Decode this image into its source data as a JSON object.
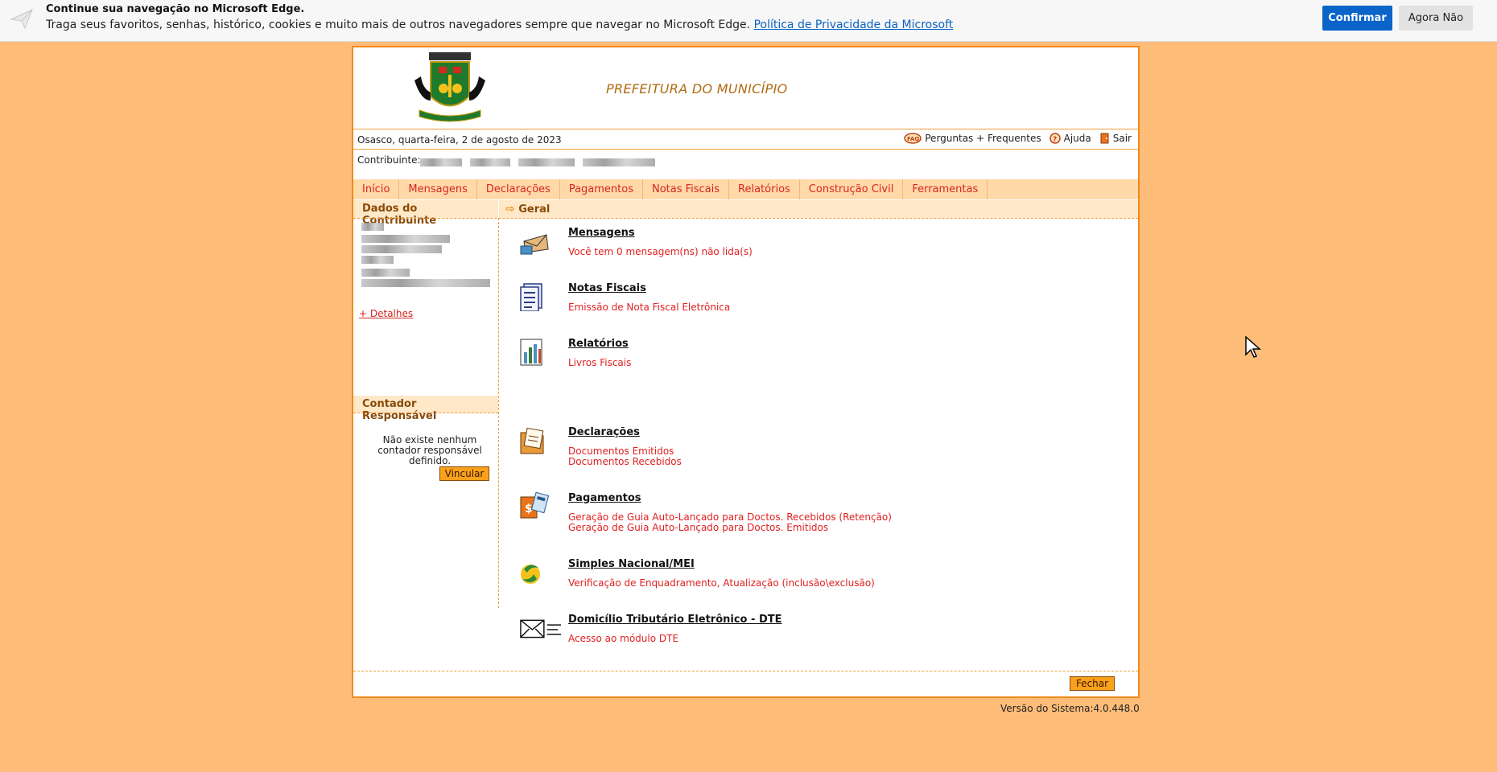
{
  "edge_bar": {
    "title": "Continue sua navegação no Microsoft Edge.",
    "text": "Traga seus favoritos, senhas, histórico, cookies e muito mais de outros navegadores sempre que navegar no Microsoft Edge.",
    "link": "Política de Privacidade da Microsoft",
    "confirm": "Confirmar",
    "later": "Agora Não"
  },
  "header": {
    "title": "PREFEITURA DO MUNICÍPIO"
  },
  "dateline": {
    "date": "Osasco, quarta-feira, 2 de agosto de 2023",
    "links": [
      "Perguntas + Frequentes",
      "Ajuda",
      "Sair"
    ]
  },
  "contribuinte_label": "Contribuinte:",
  "nav": [
    "Início",
    "Mensagens",
    "Declarações",
    "Pagamentos",
    "Notas Fiscais",
    "Relatórios",
    "Construção Civil",
    "Ferramentas"
  ],
  "sidebar": {
    "title": "Dados do Contribuinte",
    "detalhes": "+ Detalhes",
    "contador_title": "Contador Responsável",
    "contador_text": "Não existe nenhum contador responsável definido.",
    "vincular": "Vincular"
  },
  "main": {
    "title": "Geral",
    "items": [
      {
        "title": "Mensagens",
        "desc": [
          "Você tem 0 mensagem(ns) não lida(s)"
        ]
      },
      {
        "title": "Notas Fiscais",
        "desc": [
          "Emissão de Nota Fiscal Eletrônica"
        ]
      },
      {
        "title": "Relatórios",
        "desc": [
          "Livros Fiscais"
        ]
      },
      {
        "title": "Declarações",
        "desc": [
          "Documentos Emitidos",
          "Documentos Recebidos"
        ]
      },
      {
        "title": "Pagamentos",
        "desc": [
          "Geração de Guia Auto-Lançado para Doctos. Recebidos (Retenção)",
          "Geração de Guia Auto-Lançado para Doctos. Emitidos"
        ]
      },
      {
        "title": "Simples Nacional/MEI",
        "desc": [
          "Verificação de Enquadramento, Atualização (inclusão\\exclusão)"
        ]
      },
      {
        "title": "Domicílio Tributário Eletrônico - DTE",
        "desc": [
          "Acesso ao módulo DTE"
        ]
      }
    ]
  },
  "fechar": "Fechar",
  "versao": "Versão do Sistema:4.0.448.0",
  "colors": {
    "background": "#fdbd79",
    "border": "#f08a1c",
    "nav_bg": "#ffd9a8",
    "link_red": "#d7261e",
    "edge_blue": "#0a64c9"
  }
}
